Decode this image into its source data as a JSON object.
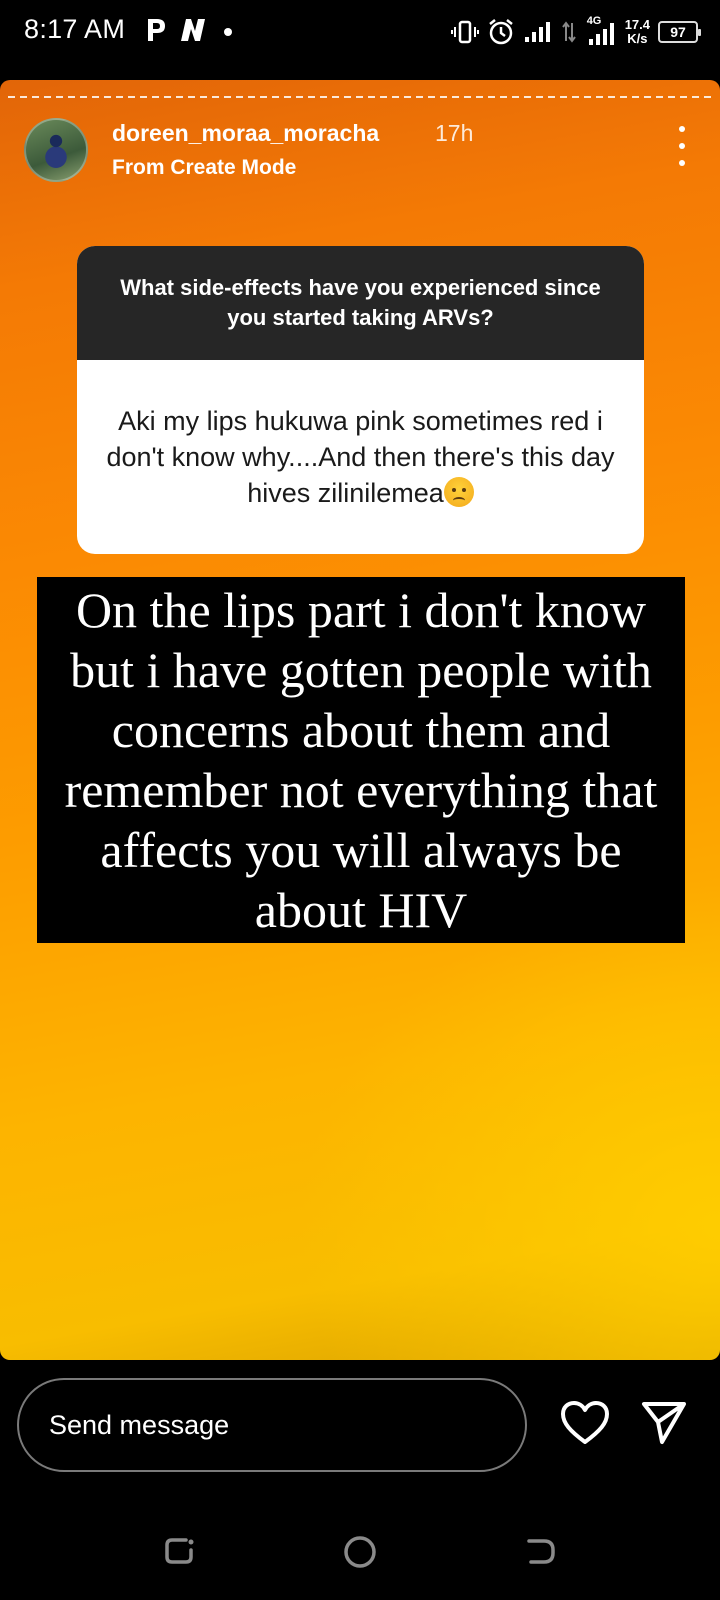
{
  "status_bar": {
    "time": "8:17 AM",
    "app_icons": [
      "p-icon",
      "n-icon",
      "dot-icon"
    ],
    "network_label": "4G",
    "net_speed_value": "17.4",
    "net_speed_unit": "K/s",
    "battery_level": "97"
  },
  "story": {
    "username": "doreen_moraa_moracha",
    "time_ago": "17h",
    "subtitle": "From Create Mode",
    "question": "What side-effects have you experienced since you started taking ARVs?",
    "answer": "Aki my lips hukuwa pink sometimes red i don't know why....And then there's this day hives zilinilemea",
    "answer_emoji": "sad-relieved-face",
    "reply_text": "On the lips part i don't know but i have gotten people with concerns about them and remember not everything that affects you will always be about HIV",
    "colors": {
      "gradient_top": "#e26508",
      "gradient_bottom": "#fdc000"
    }
  },
  "bottom_bar": {
    "message_placeholder": "Send message"
  }
}
